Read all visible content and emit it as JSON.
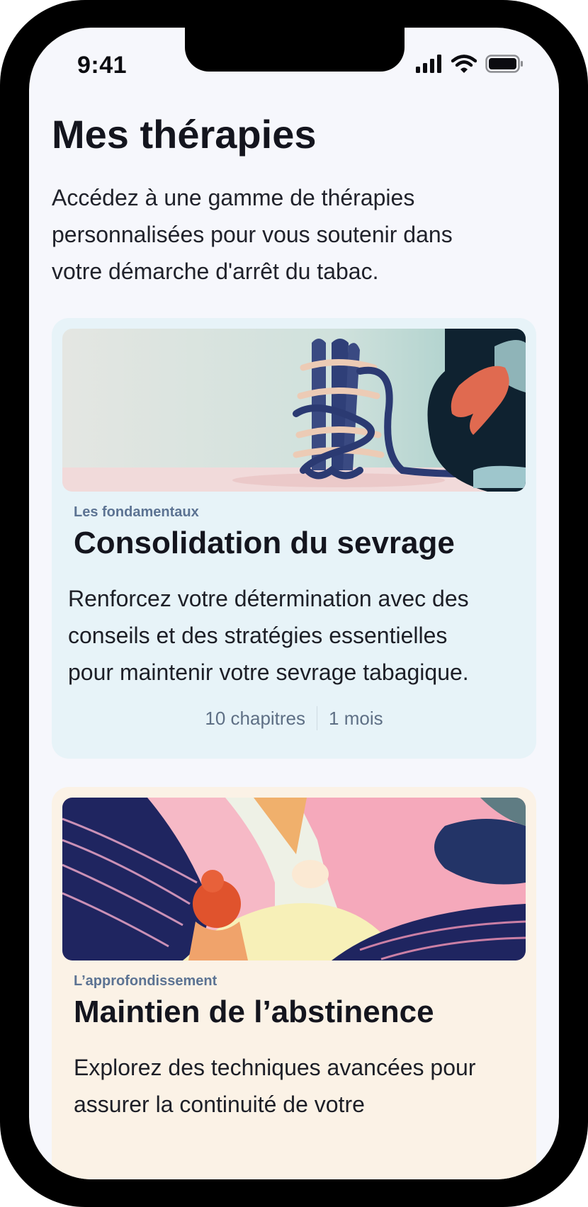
{
  "status_bar": {
    "time": "9:41"
  },
  "page": {
    "title": "Mes thérapies",
    "description": "Accédez à une gamme de thérapies personnalisées pour vous soutenir dans votre démarche d'arrêt du tabac."
  },
  "cards": [
    {
      "tag": "Les fondamentaux",
      "title": "Consolidation du sevrage",
      "description": "Renforcez votre détermination avec des conseils et des stratégies essentielles pour maintenir votre sevrage tabagique.",
      "chapters": "10 chapitres",
      "duration": "1 mois",
      "background": "#e7f3f8"
    },
    {
      "tag": "L’approfondissement",
      "title": "Maintien de l’abstinence",
      "description": "Explorez des techniques avancées pour assurer la continuité de votre",
      "background": "#fbf2e6"
    }
  ],
  "icons": [
    "signal-icon",
    "wifi-icon",
    "battery-icon"
  ]
}
